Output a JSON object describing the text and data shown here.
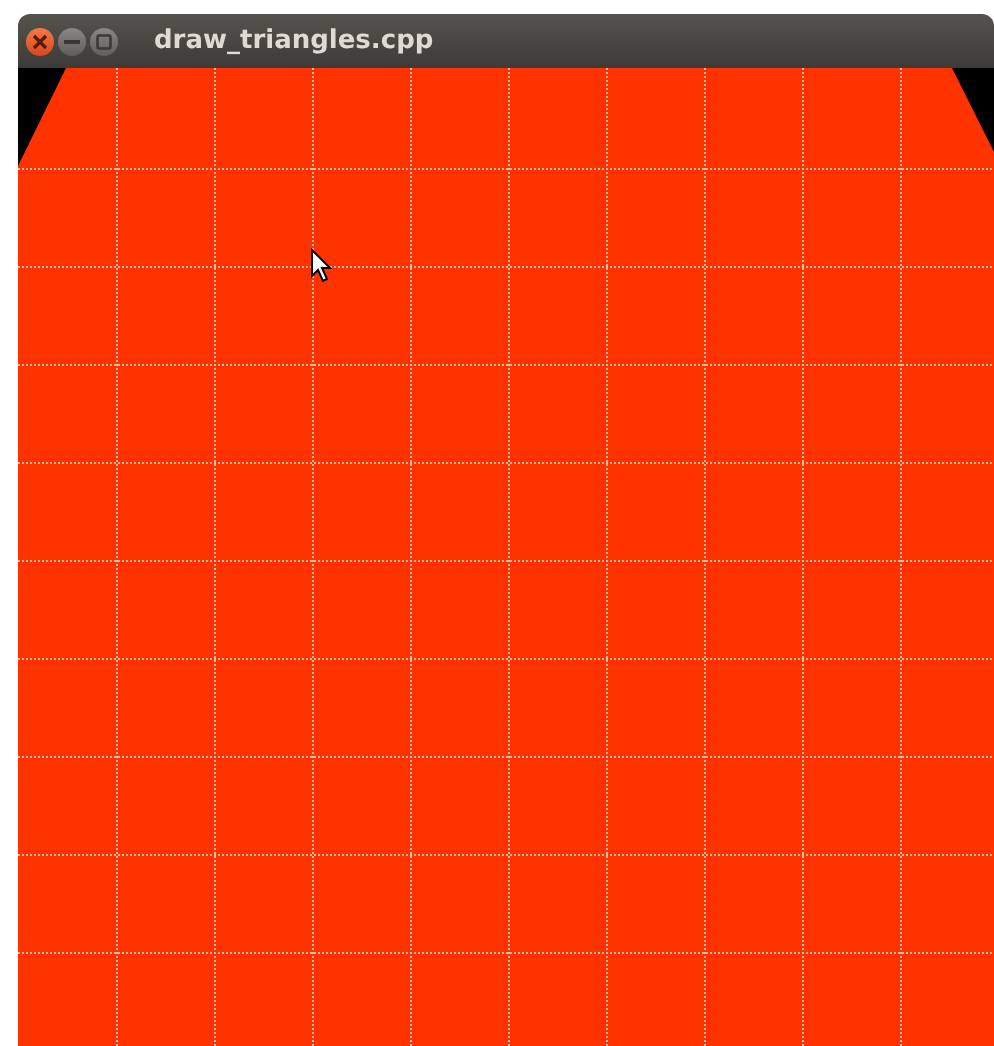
{
  "window": {
    "title": "draw_triangles.cpp"
  }
}
